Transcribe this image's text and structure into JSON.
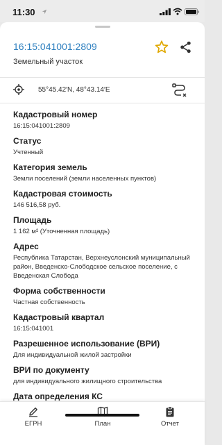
{
  "status_bar": {
    "time": "11:30"
  },
  "header": {
    "cadastral_number": "16:15:041001:2809",
    "object_type": "Земельный участок"
  },
  "location": {
    "coordinates": "55°45.42′N, 48°43.14′E"
  },
  "fields": [
    {
      "label": "Кадастровый номер",
      "value": "16:15:041001:2809"
    },
    {
      "label": "Статус",
      "value": "Учтенный"
    },
    {
      "label": "Категория земель",
      "value": "Земли поселений (земли населенных пунктов)"
    },
    {
      "label": "Кадастровая стоимость",
      "value": "146 516,58 руб."
    },
    {
      "label": "Площадь",
      "value": "1 162 м² (Уточненная площадь)"
    },
    {
      "label": "Адрес",
      "value": "Республика Татарстан, Верхнеуслонский муниципальный район, Введенско-Слободское сельское поселение, с Введенская Слобода"
    },
    {
      "label": "Форма собственности",
      "value": "Частная собственность"
    },
    {
      "label": "Кадастровый квартал",
      "value": "16:15:041001"
    },
    {
      "label": "Разрешенное использование (ВРИ)",
      "value": "Для индивидуальной жилой застройки"
    },
    {
      "label": "ВРИ по документу",
      "value": "для индивидуального жилищного строительства"
    },
    {
      "label": "Дата определения КС",
      "value": ""
    }
  ],
  "bottom_nav": [
    {
      "label": "ЕГРН",
      "icon": "pencil-icon"
    },
    {
      "label": "План",
      "icon": "map-icon"
    },
    {
      "label": "Отчет",
      "icon": "clipboard-icon"
    }
  ],
  "colors": {
    "accent": "#2d7fbf",
    "star": "#e0a800"
  }
}
